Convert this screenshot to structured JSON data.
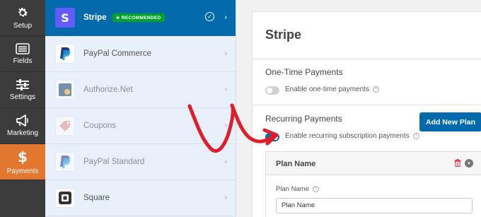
{
  "nav": [
    {
      "label": "Setup",
      "icon": "gear-icon",
      "active": false
    },
    {
      "label": "Fields",
      "icon": "list-icon",
      "active": false
    },
    {
      "label": "Settings",
      "icon": "sliders-icon",
      "active": false
    },
    {
      "label": "Marketing",
      "icon": "megaphone-icon",
      "active": false
    },
    {
      "label": "Payments",
      "icon": "dollar-icon",
      "active": true
    }
  ],
  "providers": [
    {
      "name": "Stripe",
      "badge": "★ RECOMMENDED",
      "active": true
    },
    {
      "name": "PayPal Commerce",
      "active": false
    },
    {
      "name": "Authorize.Net",
      "active": false
    },
    {
      "name": "Coupons",
      "active": false
    },
    {
      "name": "PayPal Standard",
      "active": false
    },
    {
      "name": "Square",
      "active": false
    }
  ],
  "panel": {
    "title": "Stripe",
    "one_time": {
      "heading": "One-Time Payments",
      "toggle_label": "Enable one-time payments",
      "enabled": false
    },
    "recurring": {
      "heading": "Recurring Payments",
      "toggle_label": "Enable recurring subscription payments",
      "enabled": true,
      "add_button": "Add New Plan"
    },
    "plan": {
      "header": "Plan Name",
      "field_label": "Plan Name",
      "field_value": "Plan Name"
    }
  },
  "colors": {
    "accent": "#036aab",
    "payments_active": "#e27730",
    "nav_bg": "#3c3c3c",
    "arrow": "#e01e2b",
    "badge": "#00a32a"
  }
}
